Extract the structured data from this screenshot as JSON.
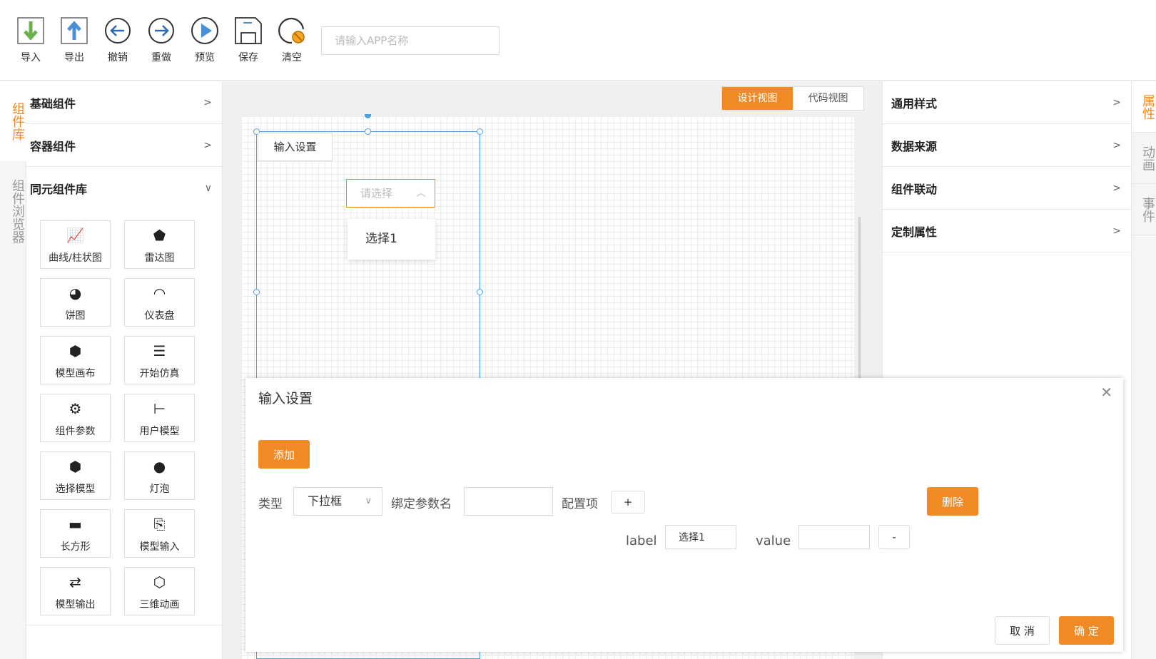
{
  "toolbar": {
    "buttons": [
      {
        "label": "导入",
        "icon": "import-icon"
      },
      {
        "label": "导出",
        "icon": "export-icon"
      },
      {
        "label": "撤销",
        "icon": "undo-icon"
      },
      {
        "label": "重做",
        "icon": "redo-icon"
      },
      {
        "label": "预览",
        "icon": "preview-icon"
      },
      {
        "label": "保存",
        "icon": "save-icon"
      },
      {
        "label": "清空",
        "icon": "clear-icon"
      }
    ],
    "app_name_placeholder": "请输入APP名称"
  },
  "left_tabs": [
    {
      "label": "组件库",
      "active": true
    },
    {
      "label": "组件浏览器",
      "active": false
    }
  ],
  "left_panel": {
    "sections": [
      {
        "label": "基础组件",
        "chevron": "›",
        "expanded": false
      },
      {
        "label": "容器组件",
        "chevron": "›",
        "expanded": false
      },
      {
        "label": "同元组件库",
        "chevron": "⌄",
        "expanded": true
      }
    ],
    "components": [
      {
        "label": "曲线/柱状图",
        "icon": "line-chart-icon",
        "glyph": "📈"
      },
      {
        "label": "雷达图",
        "icon": "radar-chart-icon",
        "glyph": "⬟"
      },
      {
        "label": "饼图",
        "icon": "pie-chart-icon",
        "glyph": "◕"
      },
      {
        "label": "仪表盘",
        "icon": "gauge-icon",
        "glyph": "◠"
      },
      {
        "label": "模型画布",
        "icon": "cube-icon",
        "glyph": "⬢"
      },
      {
        "label": "开始仿真",
        "icon": "list-icon",
        "glyph": "☰"
      },
      {
        "label": "组件参数",
        "icon": "settings-doc-icon",
        "glyph": "⚙"
      },
      {
        "label": "用户模型",
        "icon": "tree-icon",
        "glyph": "⊢"
      },
      {
        "label": "选择模型",
        "icon": "cube-select-icon",
        "glyph": "⬢"
      },
      {
        "label": "灯泡",
        "icon": "bulb-icon",
        "glyph": "●"
      },
      {
        "label": "长方形",
        "icon": "rectangle-icon",
        "glyph": "▬"
      },
      {
        "label": "模型输入",
        "icon": "model-input-icon",
        "glyph": "⎘"
      },
      {
        "label": "模型输出",
        "icon": "shuffle-icon",
        "glyph": "⇄"
      },
      {
        "label": "三维动画",
        "icon": "3d-cube-icon",
        "glyph": "⬡"
      }
    ]
  },
  "view_toggle": {
    "design": "设计视图",
    "code": "代码视图"
  },
  "canvas": {
    "component_button": "输入设置",
    "select_placeholder": "请选择",
    "dropdown_option": "选择1"
  },
  "right_panel": {
    "sections": [
      {
        "label": "通用样式"
      },
      {
        "label": "数据来源"
      },
      {
        "label": "组件联动"
      },
      {
        "label": "定制属性"
      }
    ]
  },
  "right_tabs": [
    {
      "label": "属性",
      "active": true
    },
    {
      "label": "动画",
      "active": false
    },
    {
      "label": "事件",
      "active": false
    }
  ],
  "modal": {
    "title": "输入设置",
    "add_button": "添加",
    "type_label": "类型",
    "type_value": "下拉框",
    "bind_param_label": "绑定参数名",
    "bind_param_value": "",
    "config_label": "配置项",
    "plus_button": "+",
    "delete_button": "删除",
    "label_label": "label",
    "label_value": "选择1",
    "value_label": "value",
    "value_value": "",
    "minus_button": "-",
    "cancel_button": "取 消",
    "ok_button": "确 定"
  },
  "colors": {
    "accent": "#f08a24",
    "selection": "#4a9fe9"
  }
}
